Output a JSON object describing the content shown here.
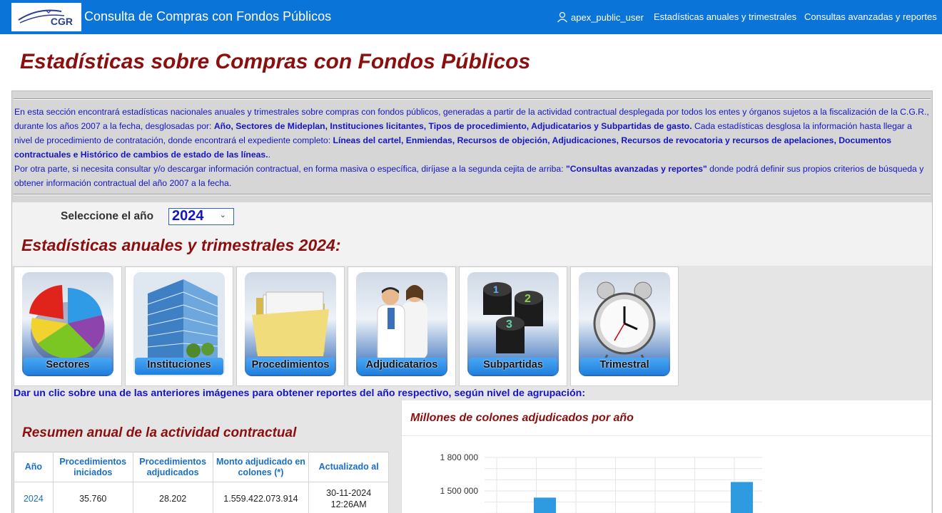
{
  "header": {
    "logo_text": "CGR",
    "app_title": "Consulta de Compras con Fondos Públicos",
    "user": "apex_public_user",
    "nav_links": [
      "Estadísticas anuales y trimestrales",
      "Consultas avanzadas y reportes"
    ]
  },
  "page": {
    "title": "Estadísticas sobre Compras con Fondos Públicos"
  },
  "intro": {
    "p1_a": "En esta sección encontrará estadísticas nacionales anuales y trimestrales sobre compras con fondos públicos, generadas a partir de la actividad contractual desplegada por todos los entes y órganos sujetos a la fiscalización de la C.G.R., durante los años 2007 a la fecha, desglosadas por: ",
    "p1_b": "Año, Sectores de Mideplan, Instituciones licitantes, Tipos de procedimiento, Adjudicatarios y Subpartidas de gasto.",
    "p1_c": " Cada estadísticas desglosa la información hasta llegar a nivel de procedimiento de contratación, donde encontrará el expediente completo: ",
    "p1_d": "Líneas del cartel, Enmiendas, Recursos de objeción, Adjudicaciones, Recursos de revocatoria y recursos de apelaciones, Documentos contractuales e Histórico de cambios de estado de las líneas.",
    "p1_e": ".",
    "p2_a": "Por otra parte, si necesita consultar y/o descargar información contractual, en forma masiva o específica, diríjase a la segunda cejita de arriba: ",
    "p2_b": "\"Consultas avanzadas y reportes\"",
    "p2_c": " donde podrá definir sus propios criterios de búsqueda y obtener información contractual del año 2007 a la fecha."
  },
  "year_selector": {
    "label": "Seleccione el año",
    "selected": "2024"
  },
  "stats_title": "Estadísticas anuales y trimestrales 2024:",
  "tiles": [
    {
      "label": "Sectores",
      "icon": "pie-chart-icon"
    },
    {
      "label": "Instituciones",
      "icon": "building-icon"
    },
    {
      "label": "Procedimientos",
      "icon": "folder-icon"
    },
    {
      "label": "Adjudicatarios",
      "icon": "people-icon"
    },
    {
      "label": "Subpartidas",
      "icon": "numbered-cylinders-icon"
    },
    {
      "label": "Trimestral",
      "icon": "alarm-clock-icon"
    }
  ],
  "click_hint": "Dar un clic sobre una de las anteriores imágenes para obtener reportes del año respectivo, según nivel de agrupación:",
  "summary": {
    "title": "Resumen anual de la actividad contractual",
    "columns": [
      "Año",
      "Procedimientos iniciados",
      "Procedimientos adjudicados",
      "Monto adjudicado en colones (*)",
      "Actualizado al"
    ],
    "rows": [
      {
        "year": "2024",
        "iniciados": "35.760",
        "adjudicados": "28.202",
        "monto": "1.559.422.073.914",
        "actualizado": "30-11-2024 12:26AM"
      }
    ]
  },
  "chart_data": {
    "type": "bar",
    "title": "Millones de colones adjudicados por año",
    "y_ticks": [
      "1 800 000",
      "1 500 000"
    ],
    "ylim_visible": [
      1300000,
      1800000
    ],
    "values_visible": [
      {
        "index": 3,
        "value": 1440000
      },
      {
        "index": 8,
        "value": 1580000
      }
    ]
  },
  "colors": {
    "topbar": "#0b74d9",
    "title_red": "#8b0f0f",
    "intro_blue": "#1515c8",
    "link_blue": "#1a6fc4",
    "bar_blue": "#2e9be0"
  }
}
